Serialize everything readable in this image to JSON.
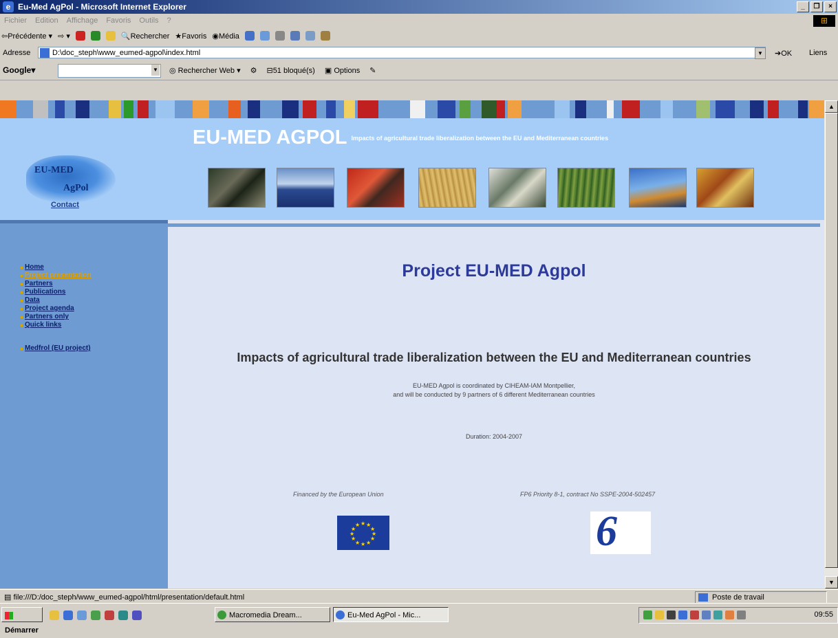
{
  "window": {
    "title": "Eu-Med AgPol - Microsoft Internet Explorer",
    "buttons": [
      "_",
      "❐",
      "×"
    ]
  },
  "menubar": {
    "items": [
      "Fichier",
      "Edition",
      "Affichage",
      "Favoris",
      "Outils",
      "?"
    ]
  },
  "toolbar": {
    "back": "Précédente",
    "search": "Rechercher",
    "favorites": "Favoris",
    "media": "Média"
  },
  "address": {
    "label": "Adresse",
    "url": "D:\\doc_steph\\www_eumed-agpol\\index.html",
    "ok": "OK",
    "links": "Liens"
  },
  "google_bar": {
    "logo": "Google",
    "search_web": "Rechercher Web",
    "blocked": "51 bloqué(s)",
    "options": "Options"
  },
  "page": {
    "brand_logo": {
      "line1": "EU-MED",
      "line2": "AgPol"
    },
    "contact": "Contact",
    "header_title": "EU-MED AGPOL",
    "header_subtitle": "Impacts of agricultural trade liberalization between the EU and Mediterranean countries",
    "nav": [
      {
        "label": "Home",
        "active": false
      },
      {
        "label": "Project presentation",
        "active": true
      },
      {
        "label": "Partners",
        "active": false
      },
      {
        "label": "Publications",
        "active": false
      },
      {
        "label": "Data",
        "active": false
      },
      {
        "label": "Project agenda",
        "active": false
      },
      {
        "label": "Partners only",
        "active": false
      },
      {
        "label": "Quick links",
        "active": false
      },
      {
        "label": "Medfrol (EU project)",
        "active": false
      }
    ],
    "title": "Project EU-MED Agpol",
    "headline": "Impacts of agricultural trade liberalization between the EU and Mediterranean countries",
    "coordination_line1": "EU-MED Agpol is coordinated by CIHEAM-IAM Montpellier,",
    "coordination_line2": "and will be conducted by 9 partners of 6 different Mediterranean countries",
    "duration": "Duration: 2004-2007",
    "financed": "Financed by the European Union",
    "contract": "FP6 Priority 8-1, contract No SSPE-2004-502457",
    "fp6_mark": "6"
  },
  "statusbar": {
    "url": "file:///D:/doc_steph/www_eumed-agpol/html/presentation/default.html",
    "zone": "Poste de travail"
  },
  "taskbar": {
    "start": "Démarrer",
    "tasks": [
      "Macromedia Dream...",
      "Eu-Med AgPol - Mic..."
    ],
    "clock": "09:55"
  },
  "colors": {
    "header_bg": "#a6cdf7",
    "sidebar_bg": "#6e9bd1",
    "content_bg": "#dde4f4",
    "title_text": "#2c3a9a",
    "nav_active": "#e0a000"
  }
}
